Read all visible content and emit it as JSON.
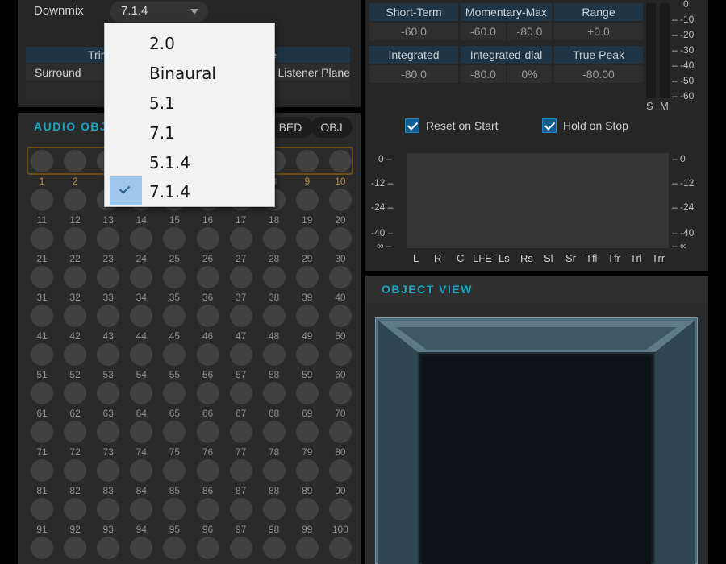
{
  "downmix": {
    "label": "Downmix",
    "value": "7.1.4"
  },
  "renderer_table": {
    "header_trim": "Trim",
    "header_right_fragment": "e",
    "row_label": "Surround",
    "row_value": "Listener Plane"
  },
  "loudness": {
    "headers_row1": [
      "Short-Term",
      "Momentary-Max",
      "Range"
    ],
    "values_row1": [
      "-60.0",
      "-60.0",
      "-80.0",
      "+0.0"
    ],
    "headers_row2": [
      "Integrated",
      "Integrated-dial",
      "True Peak"
    ],
    "values_row2": [
      "-80.0",
      "-80.0",
      "0%",
      "-80.00"
    ],
    "sm_scale": [
      "0",
      "-10",
      "-20",
      "-30",
      "-40",
      "-50",
      "-60"
    ],
    "sm_labels": [
      "S",
      "M"
    ],
    "reset_on_start": {
      "label": "Reset on Start",
      "checked": true
    },
    "hold_on_stop": {
      "label": "Hold on Stop",
      "checked": true
    },
    "meter_scale": [
      "0",
      "-12",
      "-24",
      "-40",
      "∞"
    ],
    "channels": [
      "L",
      "R",
      "C",
      "LFE",
      "Ls",
      "Rs",
      "Sl",
      "Sr",
      "Tfl",
      "Tfr",
      "Trl",
      "Trr"
    ]
  },
  "audio_objects": {
    "title": "AUDIO OBJECTS",
    "bed_button": "BED",
    "obj_button": "OBJ",
    "count_visible_labels": 100
  },
  "object_view": {
    "title": "OBJECT VIEW"
  },
  "dropdown": {
    "items": [
      {
        "label": "2.0",
        "selected": false
      },
      {
        "label": "Binaural",
        "selected": false
      },
      {
        "label": "5.1",
        "selected": false
      },
      {
        "label": "7.1",
        "selected": false
      },
      {
        "label": "5.1.4",
        "selected": false
      },
      {
        "label": "7.1.4",
        "selected": true
      }
    ]
  },
  "colors": {
    "accent": "#19a6c4",
    "header_blue": "#1f3546",
    "selection": "#9fc7ea",
    "object_highlight": "#6a4e18"
  }
}
